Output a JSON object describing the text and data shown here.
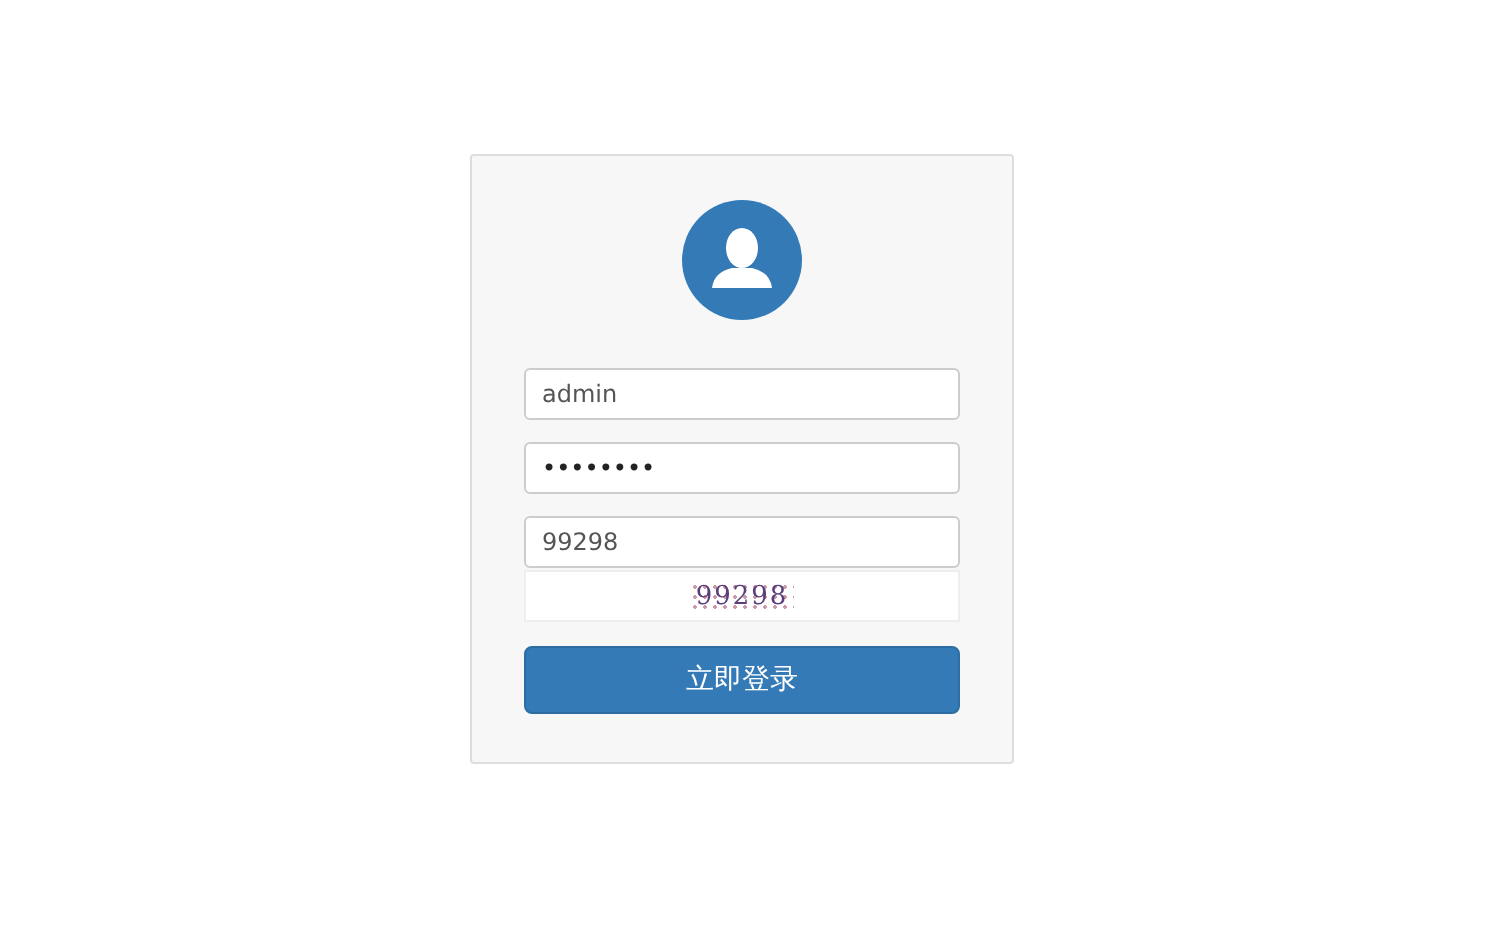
{
  "login_form": {
    "username": {
      "value": "admin"
    },
    "password": {
      "value": "••••••••"
    },
    "captcha_input": {
      "value": "99298"
    },
    "captcha_image": {
      "text": "99298"
    },
    "submit_button": {
      "label": "立即登录"
    }
  }
}
